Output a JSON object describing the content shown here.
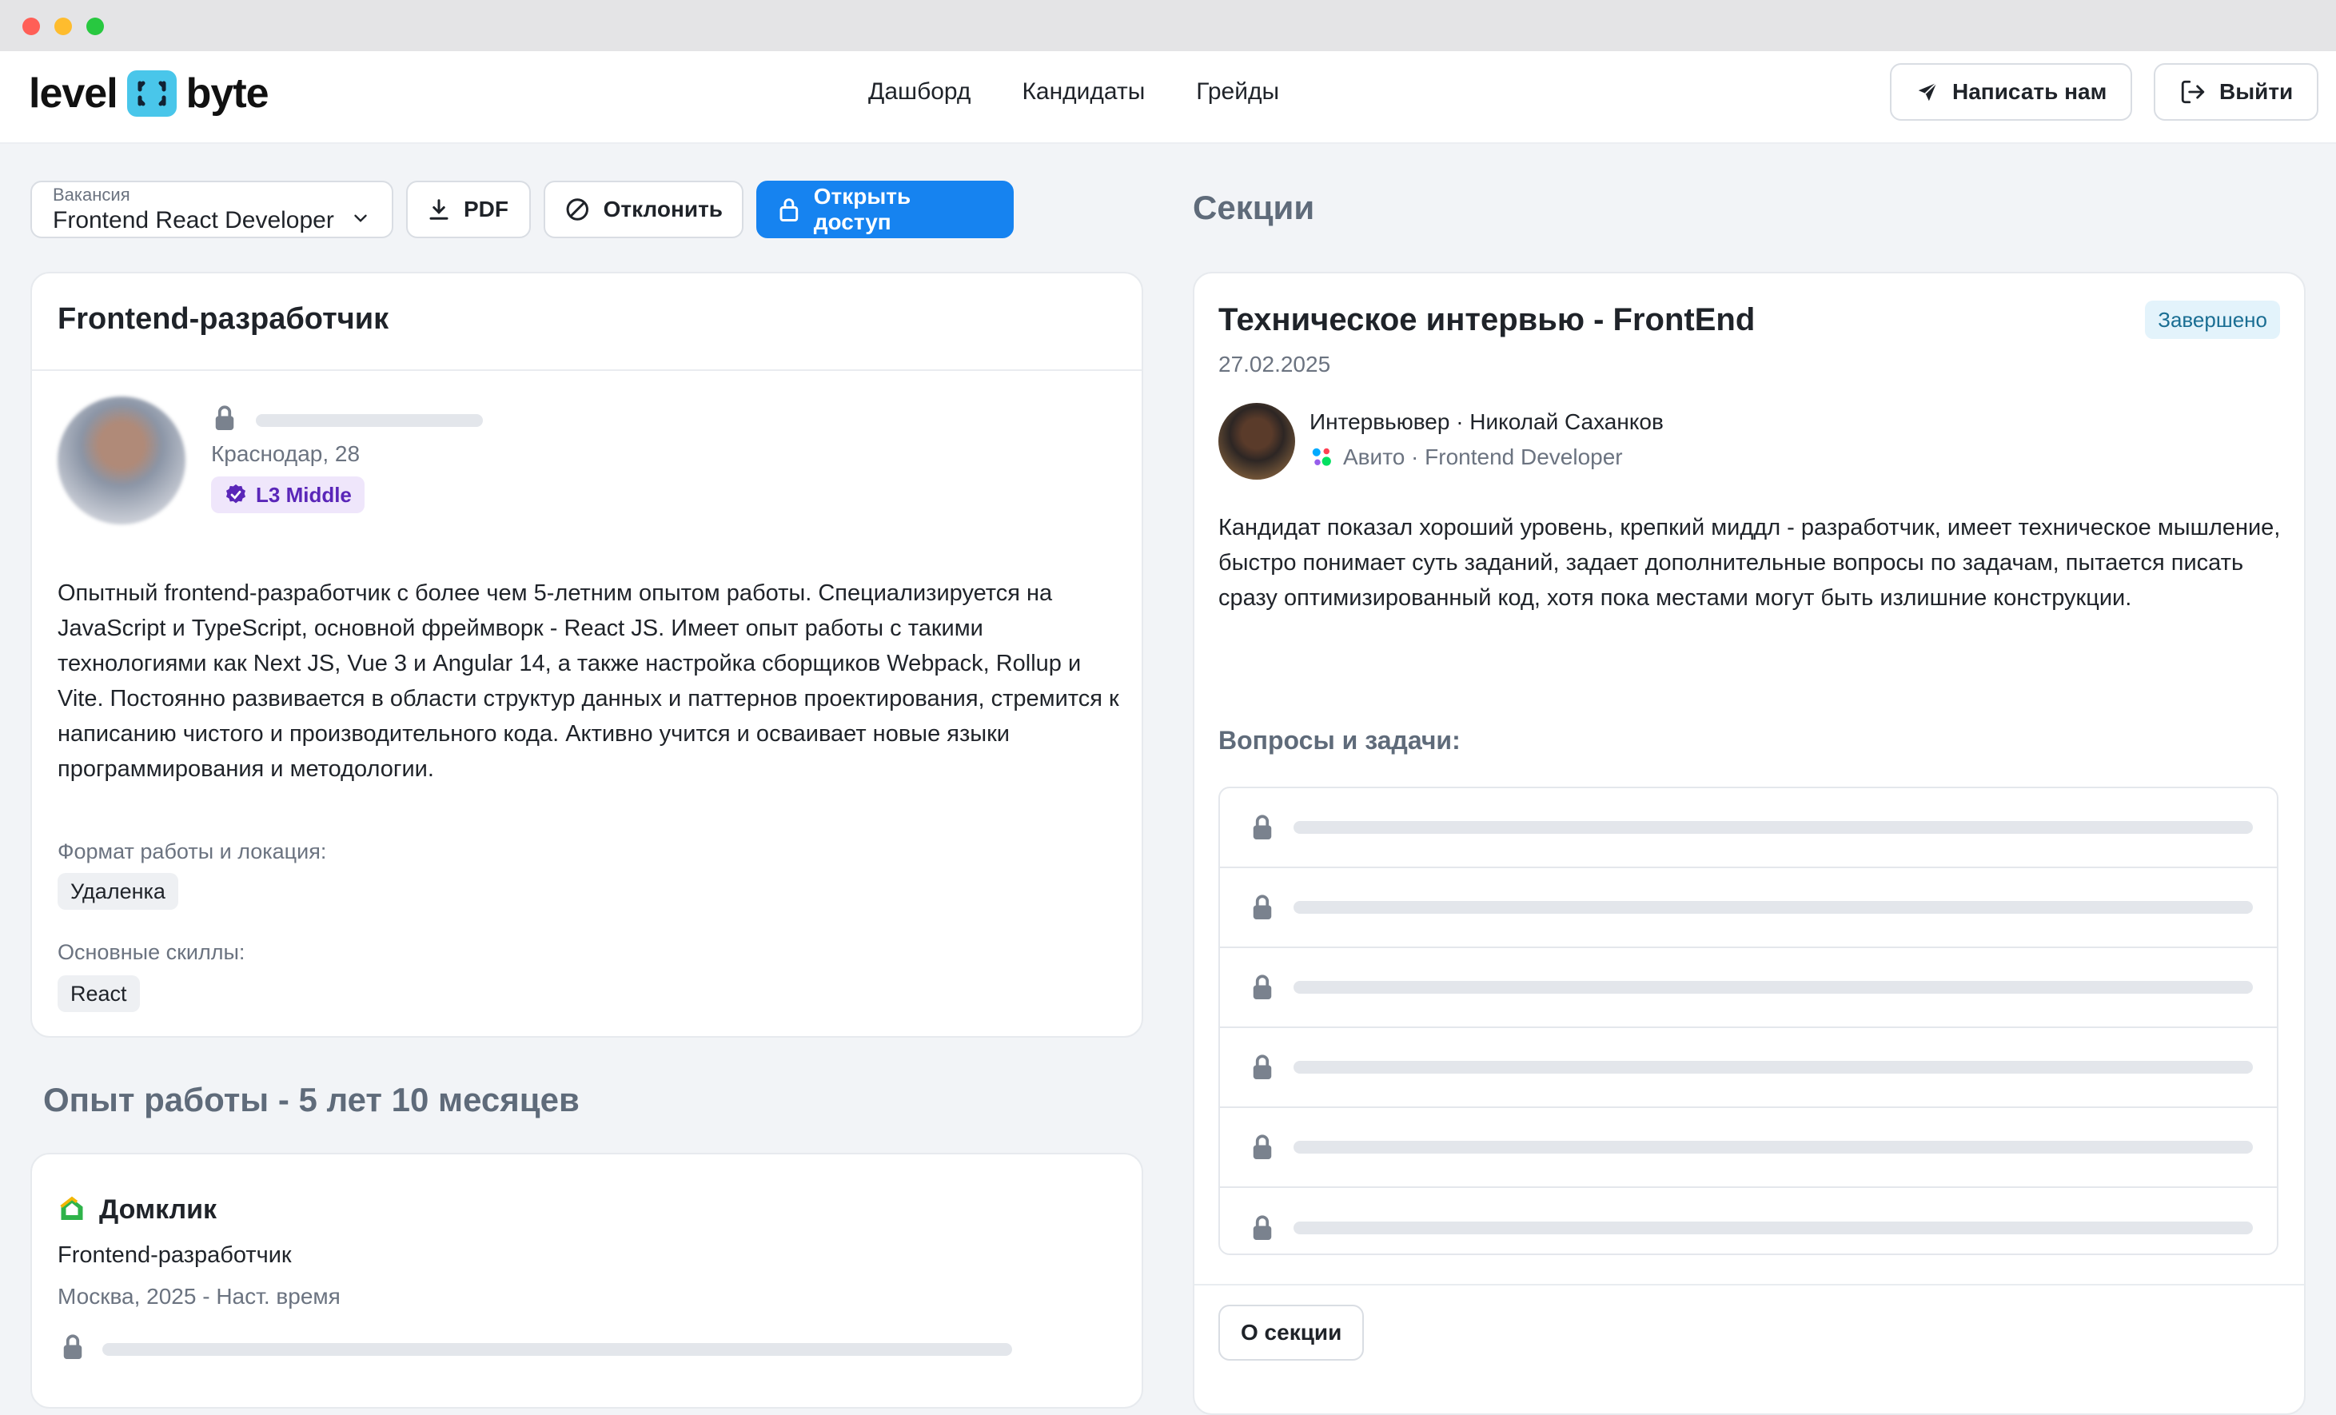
{
  "brand": {
    "word1": "level",
    "word2": "byte"
  },
  "nav": {
    "items": [
      "Дашборд",
      "Кандидаты",
      "Грейды"
    ]
  },
  "header": {
    "contact_label": "Написать нам",
    "logout_label": "Выйти"
  },
  "toolbar": {
    "vacancy_label": "Вакансия",
    "vacancy_value": "Frontend React Developer",
    "pdf_label": "PDF",
    "reject_label": "Отклонить",
    "open_access_label": "Открыть доступ"
  },
  "profile": {
    "title": "Frontend-разработчик",
    "city": "Краснодар, 28",
    "grade": "L3 Middle",
    "bio": "Опытный frontend-разработчик с более чем 5-летним опытом работы. Специализируется на JavaScript и TypeScript, основной фреймворк - React JS. Имеет опыт работы с такими технологиями как Next JS, Vue 3 и Angular 14, а также настройка сборщиков Webpack, Rollup и Vite. Постоянно развивается в области структур данных и паттернов проектирования, стремится к написанию чистого и производительного кода. Активно учится и осваивает новые языки программирования и методологии.",
    "format_label": "Формат работы и локация:",
    "format_value": "Удаленка",
    "skills_label": "Основные скиллы:",
    "skills": [
      "React"
    ]
  },
  "experience": {
    "heading": "Опыт работы - 5 лет 10 месяцев",
    "company": "Домклик",
    "role": "Frontend-разработчик",
    "location_period": "Москва,  2025 - Наст. время"
  },
  "sections": {
    "heading": "Секции",
    "interview": {
      "title": "Техническое интервью - FrontEnd",
      "status": "Завершено",
      "date": "27.02.2025",
      "interviewer": "Интервьювер · Николай Саханков",
      "company": "Авито · Frontend Developer",
      "feedback": "Кандидат показал хороший уровень, крепкий миддл - разработчик, имеет техническое мышление, быстро понимает суть заданий, задает дополнительные вопросы по задачам, пытается писать сразу оптимизированный код, хотя пока местами могут быть излишние конструкции.",
      "questions_heading": "Вопросы и задачи:",
      "locked_question_count": 6,
      "about_label": "О секции"
    }
  },
  "colors": {
    "accent": "#1683f0",
    "logo": "#49c6ea",
    "grade_bg": "#efe6fb",
    "grade_text": "#5a26b8",
    "status_bg": "#e3f3fb"
  },
  "icons": [
    "send-icon",
    "logout-icon",
    "download-icon",
    "block-icon",
    "lock-icon",
    "chevron-down-icon",
    "verified-badge-icon",
    "avito-logo-icon",
    "domclick-logo-icon"
  ]
}
